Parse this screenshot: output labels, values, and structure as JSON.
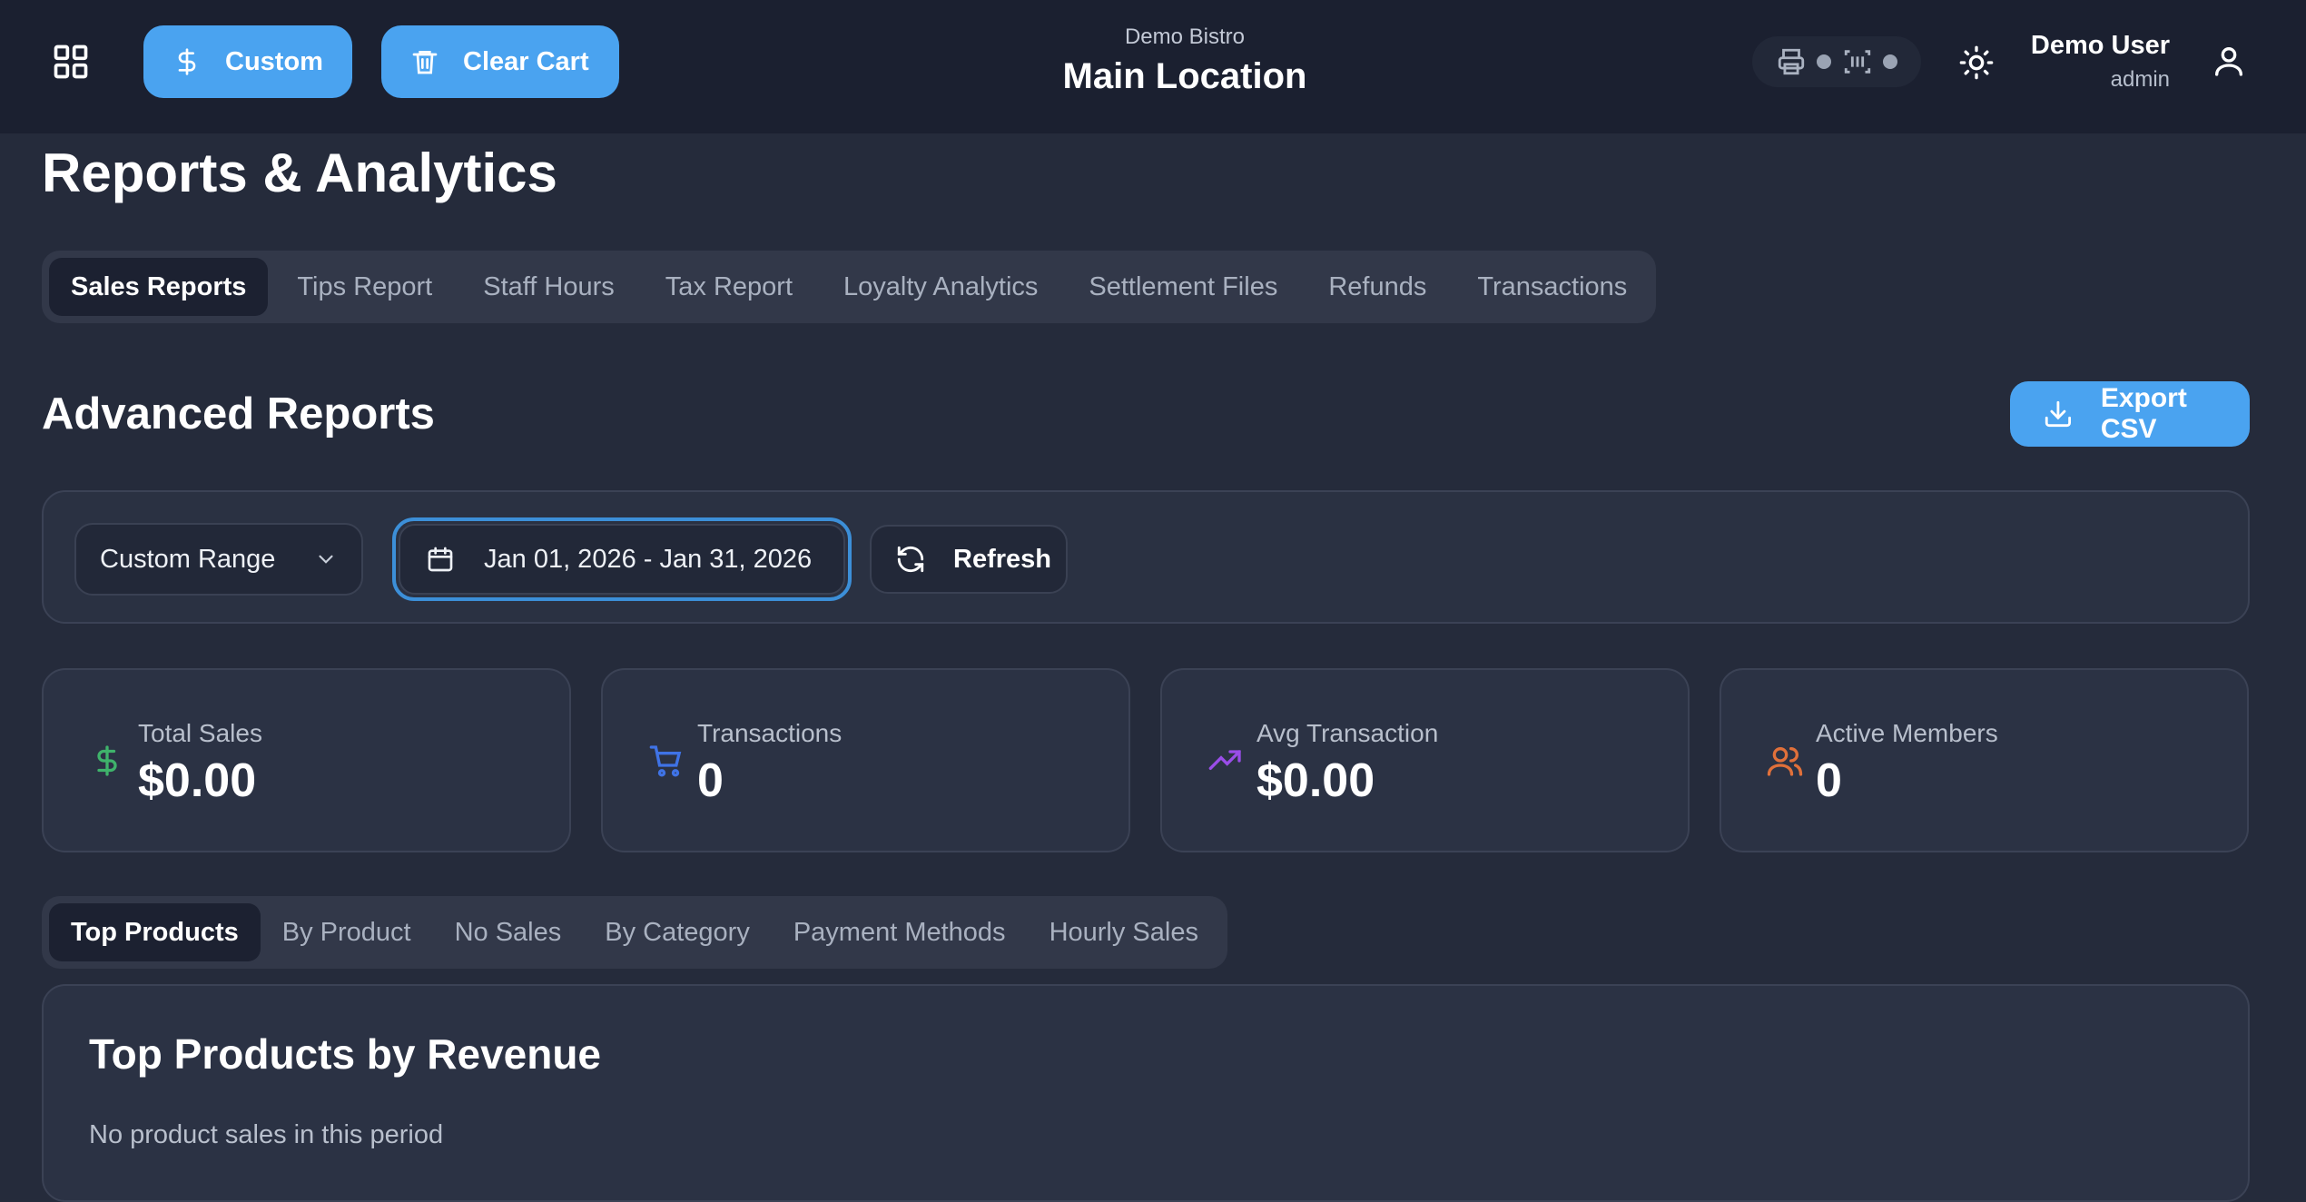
{
  "header": {
    "custom_label": "Custom",
    "clear_cart_label": "Clear Cart",
    "business_name": "Demo Bistro",
    "location_name": "Main Location",
    "user_name": "Demo User",
    "user_role": "admin"
  },
  "page": {
    "title": "Reports & Analytics"
  },
  "tabs": [
    {
      "label": "Sales Reports",
      "active": true
    },
    {
      "label": "Tips Report"
    },
    {
      "label": "Staff Hours"
    },
    {
      "label": "Tax Report"
    },
    {
      "label": "Loyalty Analytics"
    },
    {
      "label": "Settlement Files"
    },
    {
      "label": "Refunds"
    },
    {
      "label": "Transactions"
    }
  ],
  "reports": {
    "title": "Advanced Reports",
    "export_label": "Export CSV",
    "range_value": "Custom Range",
    "date_range": "Jan 01, 2026 - Jan 31, 2026",
    "refresh_label": "Refresh"
  },
  "stats": [
    {
      "label": "Total Sales",
      "value": "$0.00",
      "icon": "dollar-icon",
      "color": "#3fb36b"
    },
    {
      "label": "Transactions",
      "value": "0",
      "icon": "cart-icon",
      "color": "#3f73e6"
    },
    {
      "label": "Avg Transaction",
      "value": "$0.00",
      "icon": "trending-up-icon",
      "color": "#9a4de8"
    },
    {
      "label": "Active Members",
      "value": "0",
      "icon": "users-icon",
      "color": "#e0703a"
    }
  ],
  "subtabs": [
    {
      "label": "Top Products",
      "active": true
    },
    {
      "label": "By Product"
    },
    {
      "label": "No Sales"
    },
    {
      "label": "By Category"
    },
    {
      "label": "Payment Methods"
    },
    {
      "label": "Hourly Sales"
    }
  ],
  "top_products": {
    "title": "Top Products by Revenue",
    "empty_text": "No product sales in this period"
  },
  "colors": {
    "accent": "#4aa3f0",
    "focus": "#3c8fd8"
  }
}
